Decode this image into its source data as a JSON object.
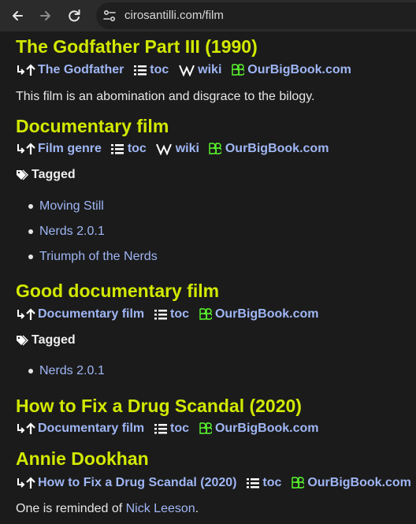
{
  "browser": {
    "url": "cirosantilli.com/film"
  },
  "sections": [
    {
      "title": "The Godfather Part III (1990)",
      "parent": "The Godfather",
      "toc": "toc",
      "wiki": "wiki",
      "obb": "OurBigBook.com",
      "text": "This film is an abomination and disgrace to the bilogy."
    },
    {
      "title": "Documentary film",
      "parent": "Film genre",
      "toc": "toc",
      "wiki": "wiki",
      "obb": "OurBigBook.com",
      "tagged_label": "Tagged",
      "tagged": [
        "Moving Still",
        "Nerds 2.0.1",
        "Triumph of the Nerds"
      ]
    },
    {
      "title": "Good documentary film",
      "parent": "Documentary film",
      "toc": "toc",
      "obb": "OurBigBook.com",
      "tagged_label": "Tagged",
      "tagged": [
        "Nerds 2.0.1"
      ]
    },
    {
      "title": "How to Fix a Drug Scandal (2020)",
      "parent": "Documentary film",
      "toc": "toc",
      "obb": "OurBigBook.com"
    },
    {
      "title": "Annie Dookhan",
      "parent": "How to Fix a Drug Scandal (2020)",
      "toc": "toc",
      "obb": "OurBigBook.com",
      "text_prefix": "One is reminded of ",
      "text_link": "Nick Leeson",
      "text_suffix": "."
    }
  ],
  "colors": {
    "heading": "#d2e900",
    "link": "#9fb6f4",
    "background": "#1b1b1b"
  }
}
